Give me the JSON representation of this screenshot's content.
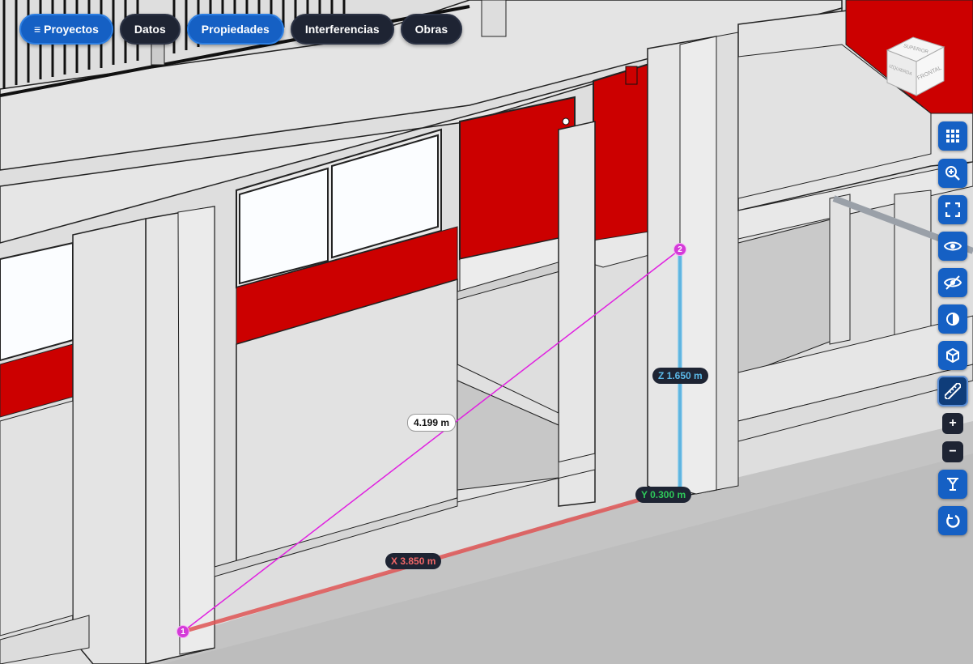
{
  "nav": {
    "proyectos_icon": "≡",
    "proyectos_label": "Proyectos",
    "datos_label": "Datos",
    "propiedades_label": "Propiedades",
    "interferencias_label": "Interferencias",
    "obras_label": "Obras"
  },
  "viewcube": {
    "top_label": "SUPERIOR",
    "left_label": "IZQUIERDA",
    "front_label": "FRONTAL"
  },
  "toolbar": {
    "zoom_in_label": "+",
    "zoom_out_label": "−",
    "icons": [
      "grid-icon",
      "zoom-area-icon",
      "fit-view-icon",
      "show-icon",
      "hide-icon",
      "contrast-icon",
      "cube-icon",
      "ruler-icon",
      "filter-icon",
      "reset-icon"
    ]
  },
  "measure": {
    "point1_label": "1",
    "point2_label": "2",
    "distance": "4.199 m",
    "x": "X 3.850 m",
    "y": "Y 0.300 m",
    "z": "Z 1.650 m"
  },
  "colors": {
    "accent_blue": "#1560c4",
    "dark_pill": "#1e2433",
    "wall_red": "#cc0000",
    "measure_magenta": "#e020e0",
    "x_axis": "#e05555",
    "y_axis": "#2ec95a",
    "z_axis": "#5bb9e8"
  }
}
